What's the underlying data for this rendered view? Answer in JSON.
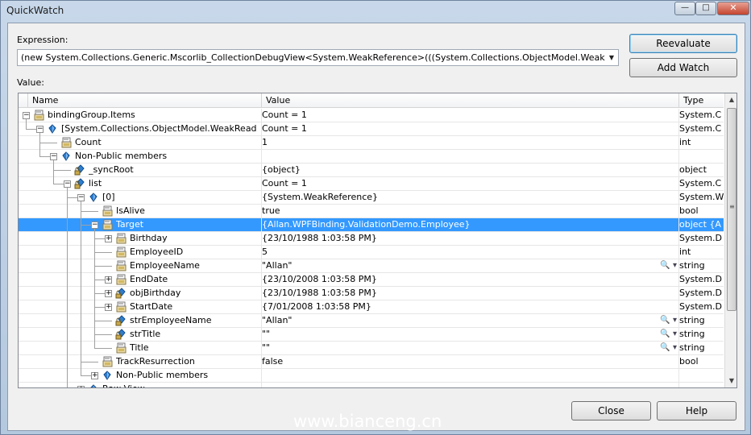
{
  "window": {
    "title": "QuickWatch"
  },
  "controls": {
    "minimize": "—",
    "maximize": "□",
    "close": "✕"
  },
  "expression": {
    "label": "Expression:",
    "value": "(new System.Collections.Generic.Mscorlib_CollectionDebugView<System.WeakReference>(((System.Collections.ObjectModel.WeakReadO"
  },
  "buttons": {
    "reevaluate": "Reevaluate",
    "add_watch": "Add Watch",
    "close": "Close",
    "help": "Help"
  },
  "value_label": "Value:",
  "columns": {
    "name": "Name",
    "value": "Value",
    "type": "Type"
  },
  "rows": [
    {
      "name": "bindingGroup.Items",
      "value": "Count = 1",
      "type": "System.C",
      "icon": "property-icon",
      "expander": "minus"
    },
    {
      "name": "[System.Collections.ObjectModel.WeakReadOnlyC",
      "value": "Count = 1",
      "type": "System.C",
      "icon": "field-icon",
      "expander": "minus"
    },
    {
      "name": "Count",
      "value": "1",
      "type": "int",
      "icon": "property-icon",
      "expander": ""
    },
    {
      "name": "Non-Public members",
      "value": "",
      "type": "",
      "icon": "field-icon",
      "expander": "minus"
    },
    {
      "name": "_syncRoot",
      "value": "{object}",
      "type": "object",
      "icon": "private-field-icon",
      "expander": ""
    },
    {
      "name": "list",
      "value": "Count = 1",
      "type": "System.C",
      "icon": "private-field-icon",
      "expander": "minus"
    },
    {
      "name": "[0]",
      "value": "{System.WeakReference}",
      "type": "System.W",
      "icon": "field-icon",
      "expander": "minus"
    },
    {
      "name": "IsAlive",
      "value": "true",
      "type": "bool",
      "icon": "property-icon",
      "expander": ""
    },
    {
      "name": "Target",
      "value": "{Allan.WPFBinding.ValidationDemo.Employee}",
      "type": "object {A",
      "icon": "property-icon",
      "expander": "minus"
    },
    {
      "name": "Birthday",
      "value": "{23/10/1988 1:03:58 PM}",
      "type": "System.D",
      "icon": "property-icon",
      "expander": "plus"
    },
    {
      "name": "EmployeeID",
      "value": "5",
      "type": "int",
      "icon": "property-icon",
      "expander": ""
    },
    {
      "name": "EmployeeName",
      "value": "\"Allan\"",
      "type": "string",
      "icon": "property-icon",
      "expander": "",
      "viz": true
    },
    {
      "name": "EndDate",
      "value": "{23/10/2008 1:03:58 PM}",
      "type": "System.D",
      "icon": "property-icon",
      "expander": "plus"
    },
    {
      "name": "objBirthday",
      "value": "{23/10/1988 1:03:58 PM}",
      "type": "System.D",
      "icon": "private-field-icon",
      "expander": "plus"
    },
    {
      "name": "StartDate",
      "value": "{7/01/2008 1:03:58 PM}",
      "type": "System.D",
      "icon": "property-icon",
      "expander": "plus"
    },
    {
      "name": "strEmployeeName",
      "value": "\"Allan\"",
      "type": "string",
      "icon": "private-field-icon",
      "expander": "",
      "viz": true
    },
    {
      "name": "strTitle",
      "value": "\"\"",
      "type": "string",
      "icon": "private-field-icon",
      "expander": "",
      "viz": true
    },
    {
      "name": "Title",
      "value": "\"\"",
      "type": "string",
      "icon": "property-icon",
      "expander": "",
      "viz": true
    },
    {
      "name": "TrackResurrection",
      "value": "false",
      "type": "bool",
      "icon": "property-icon",
      "expander": ""
    },
    {
      "name": "Non-Public members",
      "value": "",
      "type": "",
      "icon": "field-icon",
      "expander": "plus"
    },
    {
      "name": "Raw View",
      "value": "",
      "type": "",
      "icon": "field-icon",
      "expander": "plus"
    }
  ],
  "selected_row": "Target",
  "visualizer_icon": "🔍 ▾",
  "watermark": "www.bianceng.cn",
  "colors": {
    "selection": "#3399ff",
    "title_bar": "#b4c8de",
    "dialog": "#f0f0f0"
  }
}
